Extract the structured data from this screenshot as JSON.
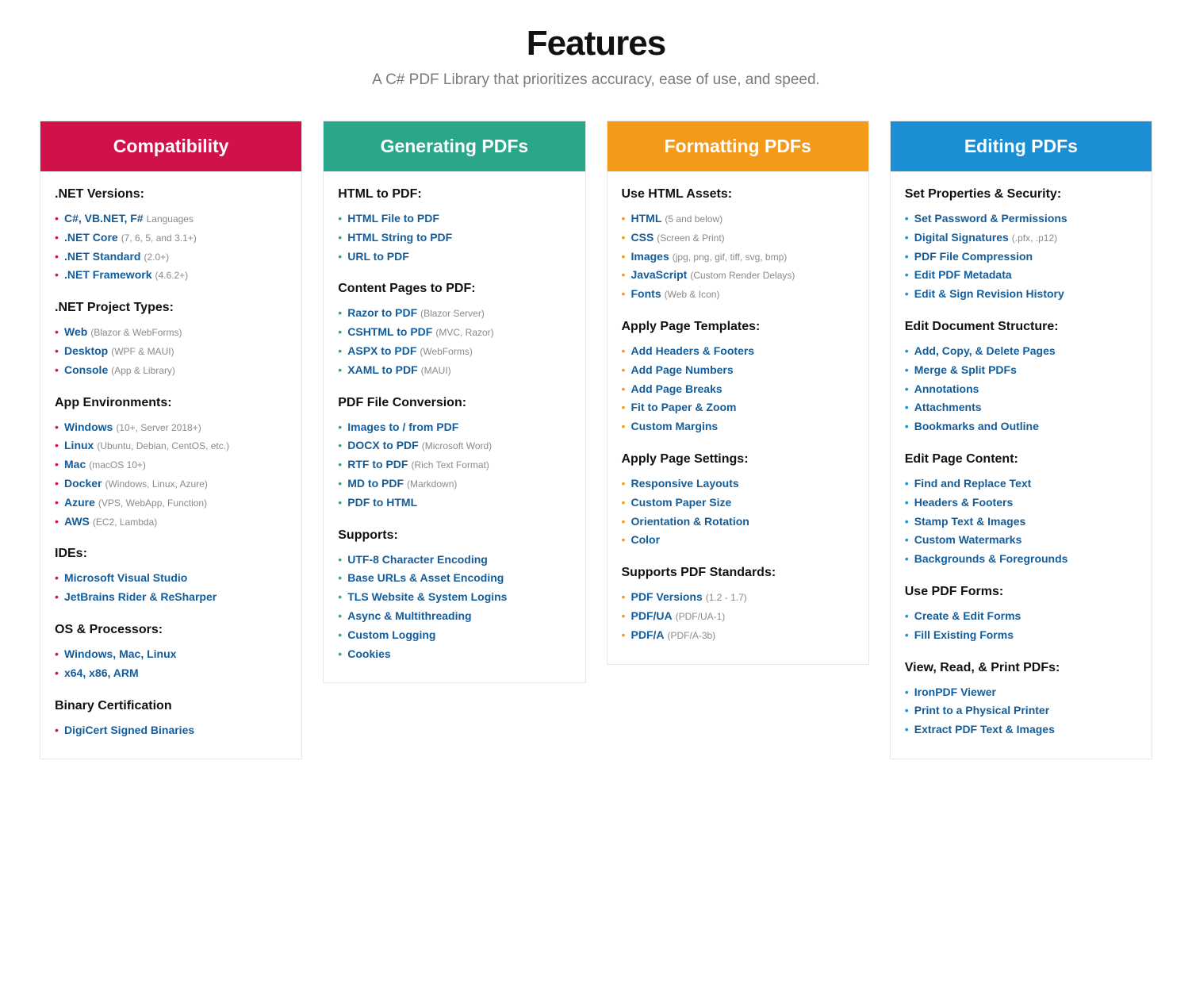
{
  "title": "Features",
  "subtitle": "A C# PDF Library that prioritizes accuracy, ease of use, and speed.",
  "columns": [
    {
      "title": "Compatibility",
      "color": "red",
      "sections": [
        {
          "title": ".NET Versions:",
          "items": [
            {
              "main": "C#, VB.NET, F#",
              "note": "Languages",
              "link": true
            },
            {
              "main": ".NET Core",
              "note": "(7, 6, 5, and 3.1+)",
              "link": true
            },
            {
              "main": ".NET Standard",
              "note": "(2.0+)",
              "link": true
            },
            {
              "main": ".NET Framework",
              "note": "(4.6.2+)",
              "link": true
            }
          ]
        },
        {
          "title": ".NET Project Types:",
          "items": [
            {
              "main": "Web",
              "note": "(Blazor & WebForms)",
              "link": true
            },
            {
              "main": "Desktop",
              "note": "(WPF & MAUI)",
              "link": true
            },
            {
              "main": "Console",
              "note": "(App & Library)",
              "link": true
            }
          ]
        },
        {
          "title": "App Environments:",
          "items": [
            {
              "main": "Windows",
              "note": "(10+, Server 2018+)",
              "link": true
            },
            {
              "main": "Linux",
              "note": "(Ubuntu, Debian, CentOS, etc.)",
              "link": true
            },
            {
              "main": "Mac",
              "note": "(macOS 10+)",
              "link": true
            },
            {
              "main": "Docker",
              "note": "(Windows, Linux, Azure)",
              "link": true
            },
            {
              "main": "Azure",
              "note": "(VPS, WebApp, Function)",
              "link": true
            },
            {
              "main": "AWS",
              "note": "(EC2, Lambda)",
              "link": true
            }
          ]
        },
        {
          "title": "IDEs:",
          "items": [
            {
              "main": "Microsoft Visual Studio",
              "link": true
            },
            {
              "main": "JetBrains Rider & ReSharper",
              "link": true
            }
          ]
        },
        {
          "title": "OS & Processors:",
          "items": [
            {
              "main": "Windows, Mac, Linux",
              "link": true
            },
            {
              "main": "x64, x86, ARM",
              "link": true
            }
          ]
        },
        {
          "title": "Binary Certification",
          "items": [
            {
              "main": "DigiCert Signed Binaries",
              "link": true
            }
          ]
        }
      ]
    },
    {
      "title": "Generating PDFs",
      "color": "teal",
      "sections": [
        {
          "title": "HTML to PDF:",
          "items": [
            {
              "main": "HTML File to PDF",
              "link": true
            },
            {
              "main": "HTML String to PDF",
              "link": true
            },
            {
              "main": "URL to PDF",
              "link": true
            }
          ]
        },
        {
          "title": "Content Pages to PDF:",
          "items": [
            {
              "main": "Razor to PDF",
              "note": "(Blazor Server)",
              "link": true
            },
            {
              "main": "CSHTML to PDF",
              "note": "(MVC, Razor)",
              "link": true
            },
            {
              "main": "ASPX to PDF",
              "note": "(WebForms)",
              "link": true
            },
            {
              "main": "XAML to PDF",
              "note": "(MAUI)",
              "link": true
            }
          ]
        },
        {
          "title": "PDF File Conversion:",
          "items": [
            {
              "main": "Images to / from PDF",
              "link": true
            },
            {
              "main": "DOCX to PDF",
              "note": "(Microsoft Word)",
              "link": true
            },
            {
              "main": "RTF to PDF",
              "note": "(Rich Text Format)",
              "link": true
            },
            {
              "main": "MD to PDF",
              "note": "(Markdown)",
              "link": true
            },
            {
              "main": "PDF to HTML",
              "link": true
            }
          ]
        },
        {
          "title": "Supports:",
          "items": [
            {
              "main": "UTF-8 Character Encoding",
              "link": true
            },
            {
              "main": "Base URLs & Asset Encoding",
              "link": true
            },
            {
              "main": "TLS Website & System Logins",
              "link": true
            },
            {
              "main": "Async & Multithreading",
              "link": true
            },
            {
              "main": "Custom Logging",
              "link": true
            },
            {
              "main": "Cookies",
              "link": true
            }
          ]
        }
      ]
    },
    {
      "title": "Formatting PDFs",
      "color": "orange",
      "sections": [
        {
          "title": "Use HTML Assets:",
          "items": [
            {
              "main": "HTML",
              "note": "(5 and below)",
              "link": true
            },
            {
              "main": "CSS",
              "note": "(Screen & Print)",
              "link": true
            },
            {
              "main": "Images",
              "note": "(jpg, png, gif, tiff, svg, bmp)",
              "link": true
            },
            {
              "main": "JavaScript",
              "note": "(Custom Render Delays)",
              "link": true
            },
            {
              "main": "Fonts",
              "note": "(Web & Icon)",
              "link": true
            }
          ]
        },
        {
          "title": "Apply Page Templates:",
          "items": [
            {
              "main": "Add Headers & Footers",
              "link": true
            },
            {
              "main": "Add Page Numbers",
              "link": true
            },
            {
              "main": "Add Page Breaks",
              "link": true
            },
            {
              "main": "Fit to Paper & Zoom",
              "link": true
            },
            {
              "main": "Custom Margins",
              "link": true
            }
          ]
        },
        {
          "title": "Apply Page Settings:",
          "items": [
            {
              "main": "Responsive Layouts",
              "link": true
            },
            {
              "main": "Custom Paper Size",
              "link": true
            },
            {
              "main": "Orientation & Rotation",
              "link": true
            },
            {
              "main": "Color",
              "link": true
            }
          ]
        },
        {
          "title": "Supports PDF Standards:",
          "items": [
            {
              "main": "PDF Versions",
              "note": "(1.2 - 1.7)",
              "link": true
            },
            {
              "main": "PDF/UA",
              "note": "(PDF/UA-1)",
              "link": true
            },
            {
              "main": "PDF/A",
              "note": "(PDF/A-3b)",
              "link": true
            }
          ]
        }
      ]
    },
    {
      "title": "Editing PDFs",
      "color": "blue",
      "sections": [
        {
          "title": "Set Properties & Security:",
          "items": [
            {
              "main": "Set Password & Permissions",
              "link": true
            },
            {
              "main": "Digital Signatures",
              "note": "(.pfx, .p12)",
              "link": true
            },
            {
              "main": "PDF File Compression",
              "link": true
            },
            {
              "main": "Edit PDF Metadata",
              "link": true
            },
            {
              "main": "Edit & Sign Revision History",
              "link": true
            }
          ]
        },
        {
          "title": "Edit Document Structure:",
          "items": [
            {
              "main": "Add, Copy, & Delete Pages",
              "link": true
            },
            {
              "main": "Merge & Split PDFs",
              "link": true
            },
            {
              "main": "Annotations",
              "link": true
            },
            {
              "main": "Attachments",
              "link": true
            },
            {
              "main": "Bookmarks and Outline",
              "link": true
            }
          ]
        },
        {
          "title": "Edit Page Content:",
          "items": [
            {
              "main": "Find and Replace Text",
              "link": true
            },
            {
              "main": "Headers & Footers",
              "link": true
            },
            {
              "main": "Stamp Text & Images",
              "link": true
            },
            {
              "main": "Custom Watermarks",
              "link": true
            },
            {
              "main": "Backgrounds & Foregrounds",
              "link": true
            }
          ]
        },
        {
          "title": "Use PDF Forms:",
          "items": [
            {
              "main": "Create & Edit Forms",
              "link": true
            },
            {
              "main": "Fill Existing Forms",
              "link": true
            }
          ]
        },
        {
          "title": "View, Read, & Print PDFs:",
          "items": [
            {
              "main": "IronPDF Viewer",
              "link": true
            },
            {
              "main": "Print to a Physical Printer",
              "link": true
            },
            {
              "main": "Extract PDF Text & Images",
              "link": true
            }
          ]
        }
      ]
    }
  ]
}
